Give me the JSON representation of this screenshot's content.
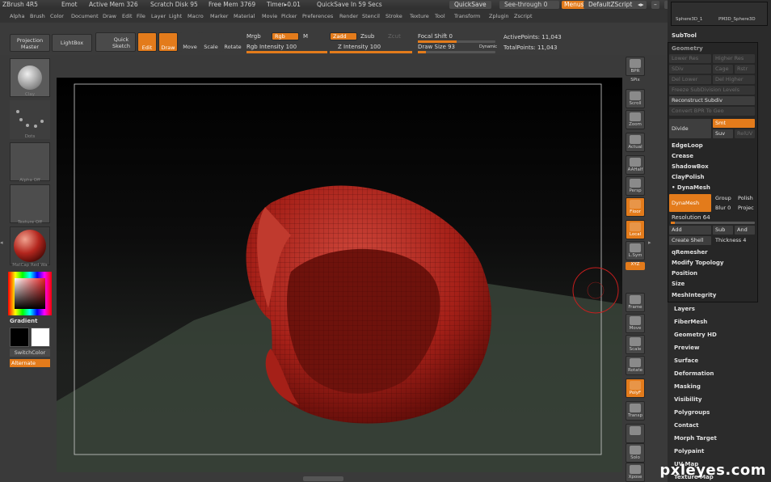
{
  "titlebar": {
    "app": "ZBrush 4R5",
    "doc": "Emot",
    "active_mem": "Active Mem 326",
    "scratch_disk": "Scratch Disk 95",
    "free_mem": "Free Mem 3769",
    "timer": "Timer▸0.01",
    "quicksave_timer": "QuickSave In 59 Secs",
    "quicksave_btn": "QuickSave",
    "see_through": "See-through",
    "see_through_val": "0",
    "menus_btn": "Menus",
    "script_btn": "DefaultZScript"
  },
  "menubar": [
    "Alpha",
    "Brush",
    "Color",
    "Document",
    "Draw",
    "Edit",
    "File",
    "Layer",
    "Light",
    "Macro",
    "Marker",
    "Material",
    "Movie",
    "Picker",
    "Preferences",
    "Render",
    "Stencil",
    "Stroke",
    "Texture",
    "Tool",
    "Transform",
    "Zplugin",
    "Zscript"
  ],
  "toolbar": {
    "projection_master": "Projection Master",
    "lightbox": "LightBox",
    "quick_sketch": "Quick Sketch",
    "edit": "Edit",
    "draw": "Draw",
    "move": "Move",
    "scale": "Scale",
    "rotate": "Rotate",
    "mrgb": "Mrgb",
    "rgb": "Rgb",
    "m": "M",
    "zadd": "Zadd",
    "zsub": "Zsub",
    "zcut": "Zcut",
    "rgb_intensity": "Rgb Intensity 100",
    "z_intensity": "Z Intensity 100",
    "focal_shift": "Focal Shift 0",
    "draw_size": "Draw Size 93",
    "dynamic": "Dynamic",
    "active_points": "ActivePoints: 11,043",
    "total_points": "TotalPoints: 11,043",
    "rgb_intensity_frac": 1.0,
    "z_intensity_frac": 1.0,
    "focal_shift_frac": 0.5,
    "draw_size_frac": 0.1
  },
  "leftshelf": {
    "brush": "Clay",
    "stroke": "Dots",
    "alpha": "Alpha Off",
    "texture": "Texture Off",
    "material": "MatCap Red Wa",
    "gradient": "Gradient",
    "switch_color": "SwitchColor",
    "alternate": "Alternate"
  },
  "rightshelf": [
    "BPR",
    "SPix",
    "Scroll",
    "Zoom",
    "Actual",
    "AAHalf",
    "Persp",
    "Floor",
    "Local",
    "L.Sym",
    "XYZ",
    "",
    "",
    "Frame",
    "Move",
    "Scale",
    "Rotate",
    "PolyF",
    "Transp",
    "",
    "Solo",
    "Xpose"
  ],
  "panel": {
    "tools_top": [
      "Sphere3D_1",
      "PM3D_Sphere3D"
    ],
    "subtool": "SubTool",
    "geometry": "Geometry",
    "lower_res": "Lower Res",
    "higher_res": "Higher Res",
    "sdiv": "SDiv",
    "cage": "Cage",
    "rstr": "Rstr",
    "del_lower": "Del Lower",
    "del_higher": "Del Higher",
    "freeze_subdiv": "Freeze SubDivision Levels",
    "reconstruct_subdiv": "Reconstruct Subdiv",
    "convert_bpr": "Convert BPR To Geo",
    "divide": "Divide",
    "smt": "Smt",
    "suv": "Suv",
    "reluv": "RelUV",
    "edgeloop": "EdgeLoop",
    "crease": "Crease",
    "shadowbox": "ShadowBox",
    "claypolish": "ClayPolish",
    "dynamesh_header": "DynaMesh",
    "dynamesh_btn": "DynaMesh",
    "group": "Group",
    "polish": "Polish",
    "blur": "Blur",
    "blur_val": "0",
    "project": "Projec",
    "resolution": "Resolution 64",
    "resolution_frac": 0.05,
    "add": "Add",
    "sub": "Sub",
    "and": "And",
    "create_shell": "Create Shell",
    "thickness": "Thickness 4",
    "qremesher": "qRemesher",
    "modify_topology": "Modify Topology",
    "position": "Position",
    "size": "Size",
    "meshintegrity": "MeshIntegrity",
    "sections": [
      "Layers",
      "FiberMesh",
      "Geometry HD",
      "Preview",
      "Surface",
      "Deformation",
      "Masking",
      "Visibility",
      "Polygroups",
      "Contact",
      "Morph Target",
      "Polypaint",
      "UV Map",
      "Texture Map"
    ]
  },
  "watermark": "pxleyes.com",
  "colors": {
    "accent": "#e37b1b",
    "mesh": "#b22222",
    "floor": "#3d4a3d"
  }
}
